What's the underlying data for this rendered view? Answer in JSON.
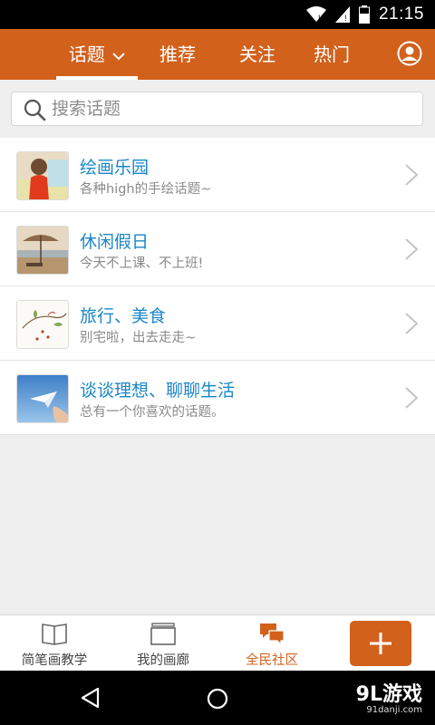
{
  "status_bar": {
    "time": "21:15"
  },
  "topnav": {
    "tabs": [
      {
        "label": "话题",
        "active": true
      },
      {
        "label": "推荐",
        "active": false
      },
      {
        "label": "关注",
        "active": false
      },
      {
        "label": "热门",
        "active": false
      }
    ],
    "accent_color": "#d2611c"
  },
  "search": {
    "placeholder": "搜索话题"
  },
  "topics": [
    {
      "title": "绘画乐园",
      "subtitle": "各种high的手绘话题~",
      "thumb": "girl-painting-thumbnail"
    },
    {
      "title": "休闲假日",
      "subtitle": "今天不上课、不上班!",
      "thumb": "beach-umbrella-thumbnail"
    },
    {
      "title": "旅行、美食",
      "subtitle": "别宅啦，出去走走~",
      "thumb": "sketch-branch-thumbnail"
    },
    {
      "title": "谈谈理想、聊聊生活",
      "subtitle": "总有一个你喜欢的话题。",
      "thumb": "paper-plane-thumbnail"
    }
  ],
  "bottombar": {
    "tabs": [
      {
        "label": "简笔画教学",
        "icon": "book-icon",
        "active": false
      },
      {
        "label": "我的画廊",
        "icon": "gallery-icon",
        "active": false
      },
      {
        "label": "全民社区",
        "icon": "chat-bubbles-icon",
        "active": true
      }
    ],
    "add_icon": "plus-icon"
  },
  "watermark": {
    "main": "9L游戏",
    "sub": "91danji.com"
  }
}
